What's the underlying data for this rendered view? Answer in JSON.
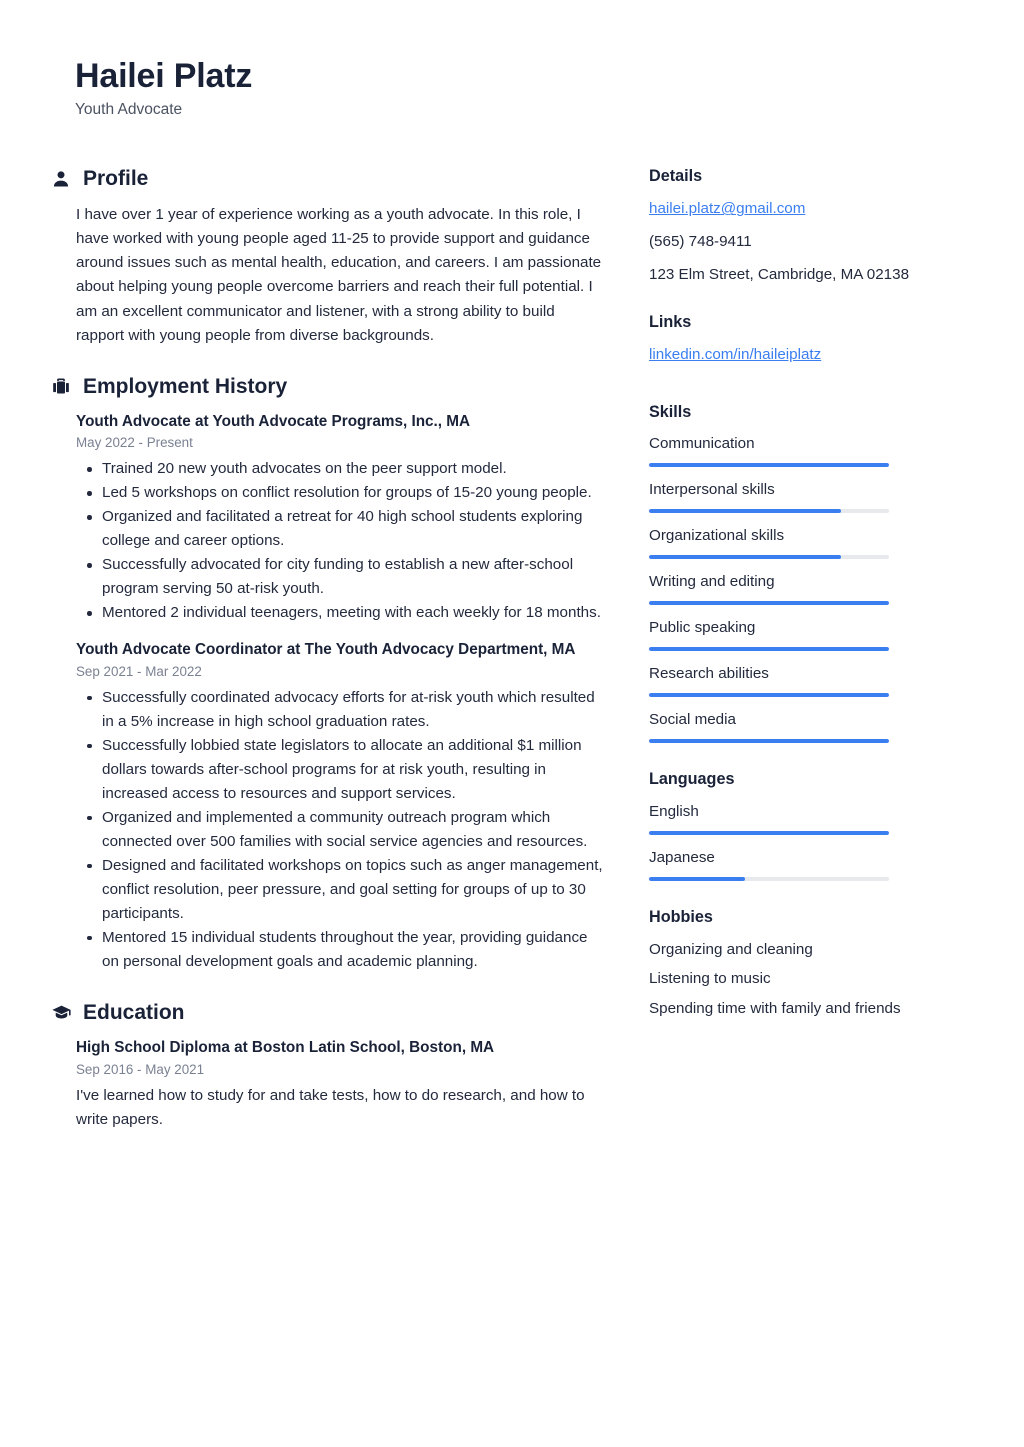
{
  "header": {
    "full_name": "Hailei Platz",
    "job_title": "Youth Advocate"
  },
  "theme": {
    "accent": "#3b7ef0",
    "text": "#232a3d",
    "heading": "#1a2238",
    "muted": "#7a8192",
    "track": "#e7e9ec",
    "background": "#ffffff"
  },
  "sections": {
    "profile": {
      "icon": "user-icon",
      "title": "Profile",
      "text": "I have over 1 year of experience working as a youth advocate. In this role, I have worked with young people aged 11-25 to provide support and guidance around issues such as mental health, education, and careers. I am passionate about helping young people overcome barriers and reach their full potential. I am an excellent communicator and listener, with a strong ability to build rapport with young people from diverse backgrounds."
    },
    "employment": {
      "icon": "briefcase-icon",
      "title": "Employment History",
      "entries": [
        {
          "title": "Youth Advocate at Youth Advocate Programs, Inc., MA",
          "date": "May 2022 - Present",
          "bullets": [
            "Trained 20 new youth advocates on the peer support model.",
            "Led 5 workshops on conflict resolution for groups of 15-20 young people.",
            "Organized and facilitated a retreat for 40 high school students exploring college and career options.",
            "Successfully advocated for city funding to establish a new after-school program serving 50 at-risk youth.",
            "Mentored 2 individual teenagers, meeting with each weekly for 18 months."
          ]
        },
        {
          "title": "Youth Advocate Coordinator at The Youth Advocacy Department, MA",
          "date": "Sep 2021 - Mar 2022",
          "bullets": [
            "Successfully coordinated advocacy efforts for at-risk youth which resulted in a 5% increase in high school graduation rates.",
            "Successfully lobbied state legislators to allocate an additional $1 million dollars towards after-school programs for at risk youth, resulting in increased access to resources and support services.",
            "Organized and implemented a community outreach program which connected over 500 families with social service agencies and resources.",
            "Designed and facilitated workshops on topics such as anger management, conflict resolution, peer pressure, and goal setting for groups of up to 30 participants.",
            "Mentored 15 individual students throughout the year, providing guidance on personal development goals and academic planning."
          ]
        }
      ]
    },
    "education": {
      "icon": "graduation-cap-icon",
      "title": "Education",
      "entries": [
        {
          "title": "High School Diploma at Boston Latin School, Boston, MA",
          "date": "Sep 2016 - May 2021",
          "description": "I've learned how to study for and take tests, how to do research, and how to write papers."
        }
      ]
    }
  },
  "sidebar": {
    "details": {
      "title": "Details",
      "email": "hailei.platz@gmail.com",
      "phone": "(565) 748-9411",
      "address": "123 Elm Street, Cambridge, MA 02138"
    },
    "links": {
      "title": "Links",
      "items": [
        {
          "label": "linkedin.com/in/haileiplatz"
        }
      ]
    },
    "skills": {
      "title": "Skills",
      "items": [
        {
          "label": "Communication",
          "level": 100
        },
        {
          "label": "Interpersonal skills",
          "level": 80
        },
        {
          "label": "Organizational skills",
          "level": 80
        },
        {
          "label": "Writing and editing",
          "level": 100
        },
        {
          "label": "Public speaking",
          "level": 100
        },
        {
          "label": "Research abilities",
          "level": 100
        },
        {
          "label": "Social media",
          "level": 100
        }
      ]
    },
    "languages": {
      "title": "Languages",
      "items": [
        {
          "label": "English",
          "level": 100
        },
        {
          "label": "Japanese",
          "level": 40
        }
      ]
    },
    "hobbies": {
      "title": "Hobbies",
      "items": [
        {
          "label": "Organizing and cleaning"
        },
        {
          "label": "Listening to music"
        },
        {
          "label": "Spending time with family and friends"
        }
      ]
    }
  }
}
